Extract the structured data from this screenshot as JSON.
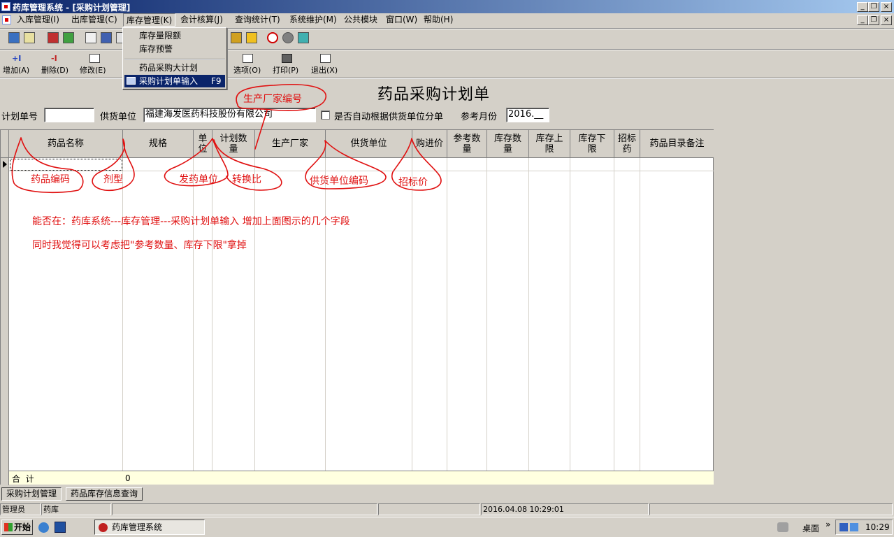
{
  "window": {
    "title": "药库管理系统 - [采购计划管理]",
    "min": "_",
    "restore": "❐",
    "close": "×"
  },
  "menu": {
    "items": [
      "入库管理(I)",
      "出库管理(C)",
      "库存管理(K)",
      "会计核算(J)",
      "查询统计(T)",
      "系统维护(M)",
      "公共模块",
      "窗口(W)",
      "帮助(H)"
    ]
  },
  "dropdown": {
    "items": [
      "库存量限额",
      "库存预警",
      "药品采购大计划",
      "采购计划单输入"
    ],
    "shortcut": "F9"
  },
  "toolbar2": {
    "labels": [
      "增加(A)",
      "删除(D)",
      "修改(E)",
      "选项(O)",
      "打印(P)",
      "退出(X)"
    ]
  },
  "form": {
    "title": "药品采购计划单",
    "plan_no_label": "计划单号",
    "plan_no_value": "",
    "supplier_label": "供货单位",
    "supplier_value": "福建海发医药科技股份有限公司",
    "auto_split_label": "是否自动根据供货单位分单",
    "ref_month_label": "参考月份",
    "ref_month_value": "2016.__"
  },
  "grid": {
    "columns": [
      "药品名称",
      "规格",
      "单\n位",
      "计划数\n量",
      "生产厂家",
      "供货单位",
      "购进价",
      "参考数\n量",
      "库存数\n量",
      "库存上\n限",
      "库存下\n限",
      "招标\n药",
      "药品目录备注"
    ],
    "total_label": "合  计",
    "total_value": "0"
  },
  "annotations": {
    "manufacturer_code": "生产厂家编号",
    "drug_code": "药品编码",
    "dosage_form": "剂型",
    "dispense_unit": "发药单位",
    "conversion_ratio": "转换比",
    "supplier_code": "供货单位编码",
    "bid_price": "招标价",
    "note1": "能否在：药库系统---库存管理---采购计划单输入  增加上面图示的几个字段",
    "note2": "同时我觉得可以考虑把\"参考数量、库存下限\"拿掉"
  },
  "tabs": [
    "采购计划管理",
    "药品库存信息查询"
  ],
  "status": {
    "user": "管理员",
    "dept": "药库",
    "datetime": "2016.04.08 10:29:01"
  },
  "taskbar": {
    "start": "开始",
    "app": "药库管理系统",
    "desktop": "桌面",
    "time": "10:29"
  },
  "colors": {
    "titlebar": "#0a246a",
    "annotation": "#e01010",
    "menu_selected": "#0a246a"
  }
}
